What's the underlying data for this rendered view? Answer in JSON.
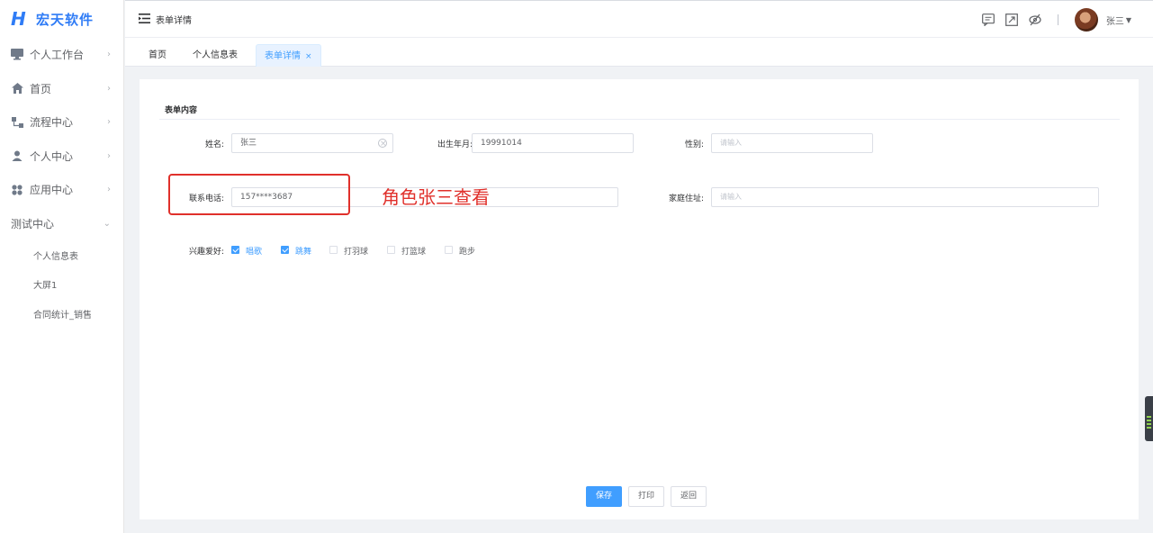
{
  "app": {
    "logo_mark": "H",
    "name": "宏天软件"
  },
  "sidebar": {
    "items": [
      {
        "label": "个人工作台",
        "icon": "monitor-icon"
      },
      {
        "label": "首页",
        "icon": "home-icon"
      },
      {
        "label": "流程中心",
        "icon": "flow-icon"
      },
      {
        "label": "个人中心",
        "icon": "user-icon"
      },
      {
        "label": "应用中心",
        "icon": "apps-icon"
      },
      {
        "label": "测试中心",
        "icon": ""
      }
    ],
    "sub_items": [
      {
        "label": "个人信息表"
      },
      {
        "label": "大屏1"
      },
      {
        "label": "合同统计_销售"
      }
    ]
  },
  "header": {
    "title": "表单详情",
    "user": "张三"
  },
  "tabs": [
    {
      "label": "首页"
    },
    {
      "label": "个人信息表"
    },
    {
      "label": "表单详情",
      "active": true
    }
  ],
  "form": {
    "section_title": "表单内容",
    "name_label": "姓名:",
    "name_value": "张三",
    "birth_label": "出生年月:",
    "birth_value": "19991014",
    "gender_label": "性别:",
    "gender_placeholder": "请输入",
    "phone_label": "联系电话:",
    "phone_value": "157****3687",
    "address_label": "家庭住址:",
    "address_placeholder": "请输入",
    "hobby_label": "兴趣爱好:",
    "hobbies": [
      {
        "label": "唱歌",
        "checked": true
      },
      {
        "label": "跳舞",
        "checked": true
      },
      {
        "label": "打羽球",
        "checked": false
      },
      {
        "label": "打篮球",
        "checked": false
      },
      {
        "label": "跑步",
        "checked": false
      }
    ]
  },
  "annotation": {
    "text": "角色张三查看",
    "color": "#e0302b"
  },
  "buttons": {
    "save": "保存",
    "print": "打印",
    "back": "返回"
  },
  "colors": {
    "brand": "#2f7cf6",
    "primary": "#409eff",
    "annotation": "#e0302b"
  }
}
